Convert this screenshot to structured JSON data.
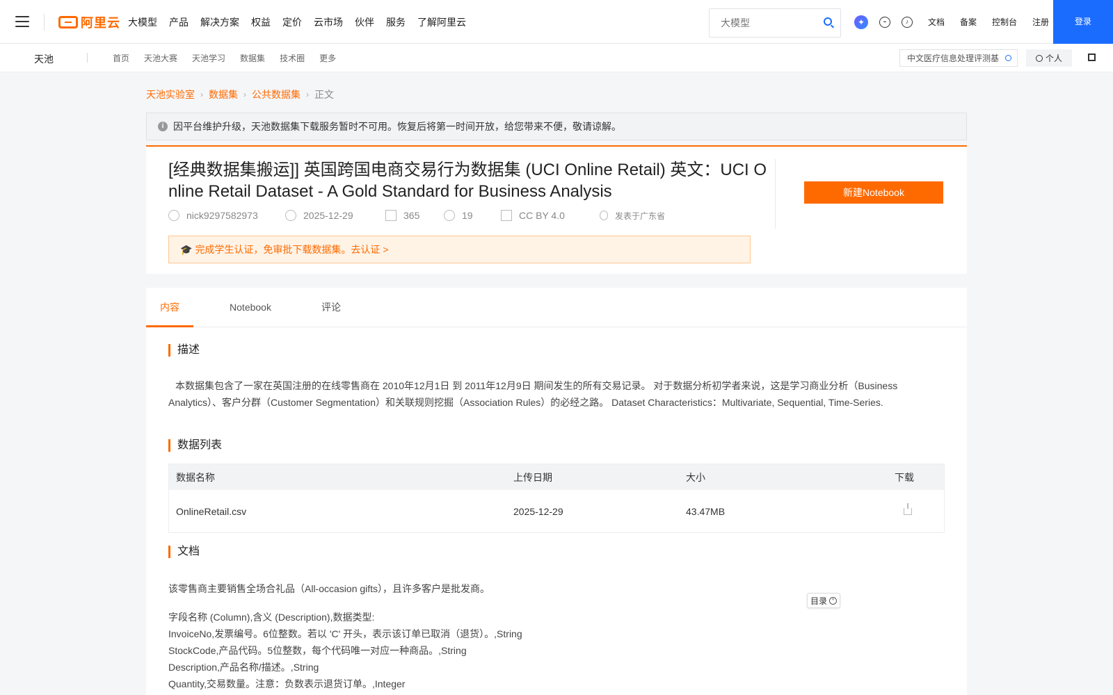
{
  "topbar": {
    "logo_text": "阿里云",
    "nav": [
      "大模型",
      "产品",
      "解决方案",
      "权益",
      "定价",
      "云市场",
      "伙伴",
      "服务",
      "了解阿里云"
    ],
    "search_placeholder": "大模型",
    "links": [
      "文档",
      "备案",
      "控制台",
      "注册"
    ],
    "login": "登录"
  },
  "subbar": {
    "brand": "天池",
    "nav": [
      "首页",
      "天池大赛",
      "天池学习",
      "数据集",
      "技术圈",
      "更多"
    ],
    "search_value": "中文医疗信息处理评测基",
    "personal": "个人"
  },
  "breadcrumb": [
    "天池实验室",
    "数据集",
    "公共数据集",
    "正文"
  ],
  "notice": "因平台维护升级，天池数据集下载服务暂时不可用。恢复后将第一时间开放，给您带来不便，敬请谅解。",
  "dataset": {
    "title": "[经典数据集搬运]] 英国跨国电商交易行为数据集 (UCI Online Retail) 英文：UCI Online Retail Dataset - A Gold Standard for Business Analysis",
    "author": "nick9297582973",
    "date": "2025-12-29",
    "downloads": "365",
    "citations": "19",
    "license": "CC BY 4.0",
    "location": "发表于广东省",
    "new_notebook": "新建Notebook",
    "student_notice": "完成学生认证，免审批下载数据集。去认证 >"
  },
  "tabs": [
    "内容",
    "Notebook",
    "评论"
  ],
  "sections": {
    "description_title": "描述",
    "description": "本数据集包含了一家在英国注册的在线零售商在 2010年12月1日 到 2011年12月9日 期间发生的所有交易记录。 对于数据分析初学者来说，这是学习商业分析（Business Analytics）、客户分群（Customer Segmentation）和关联规则挖掘（Association Rules）的必经之路。 Dataset Characteristics：Multivariate, Sequential, Time-Series.",
    "list_title": "数据列表",
    "table_headers": [
      "数据名称",
      "上传日期",
      "大小",
      "下载"
    ],
    "table_rows": [
      {
        "name": "OnlineRetail.csv",
        "date": "2025-12-29",
        "size": "43.47MB"
      }
    ],
    "docs_title": "文档",
    "toc": "目录",
    "docs_lines": [
      "该零售商主要销售全场合礼品（All-occasion gifts），且许多客户是批发商。",
      "字段名称 (Column),含义 (Description),数据类型:",
      "InvoiceNo,发票编号。6位整数。若以 'C' 开头，表示该订单已取消（退货）。,String",
      "StockCode,产品代码。5位整数，每个代码唯一对应一种商品。,String",
      "Description,产品名称/描述。,String",
      "Quantity,交易数量。注意：负数表示退货订单。,Integer"
    ]
  },
  "colors": {
    "accent": "#ff6a00",
    "primary": "#1a6cff"
  }
}
